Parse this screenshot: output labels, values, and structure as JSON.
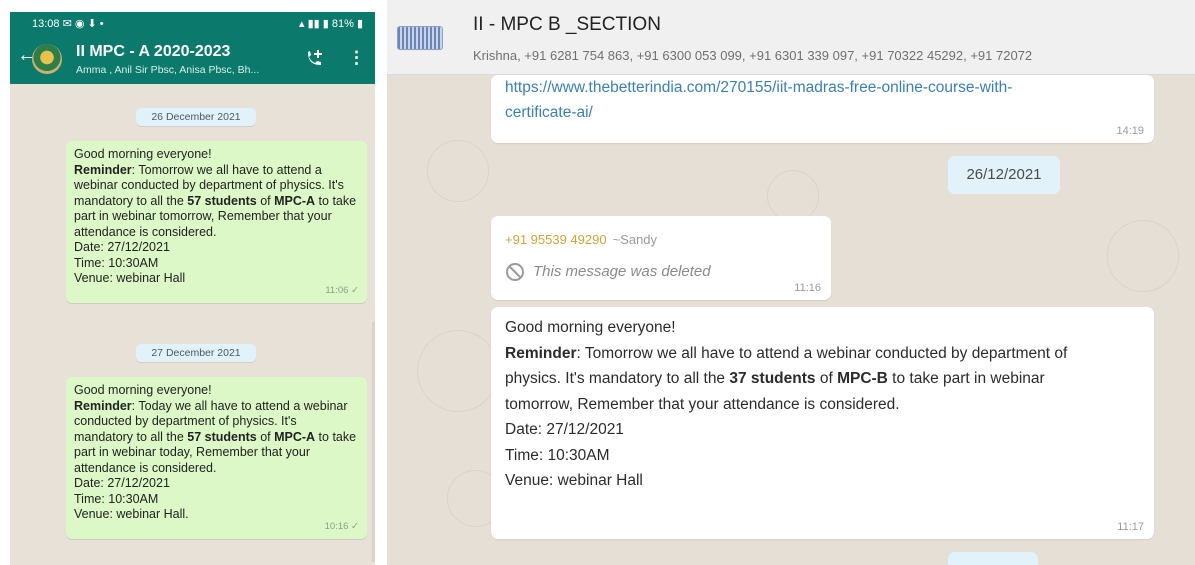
{
  "phone": {
    "status_time": "13:08",
    "status_icons": "✉ ◉ ⬇ •",
    "battery": "81%",
    "group_name": "II MPC - A 2020-2023",
    "group_members": "Amma , Anil Sir Pbsc, Anisa Pbsc, Bh...",
    "date1": "26 December 2021",
    "date2": "27 December 2021",
    "msg1": {
      "greeting": "Good morning everyone!",
      "reminder_label": "Reminder",
      "body_a": ": Tomorrow we all have to attend a webinar conducted by department of physics. It's mandatory to all the ",
      "count": "57 students",
      "of": " of ",
      "section": "MPC-A",
      "body_b": " to take part in webinar tomorrow, Remember that your attendance is considered.",
      "date_line": "Date: 27/12/2021",
      "time_line": "Time: 10:30AM",
      "venue_line": "Venue: webinar Hall",
      "time": "11:06 ✓"
    },
    "msg2": {
      "greeting": "Good morning everyone!",
      "reminder_label": "Reminder",
      "body_a": ": Today we all have to attend a webinar conducted by department of physics. It's mandatory to all the ",
      "count": "57 students",
      "of": " of ",
      "section": "MPC-A",
      "body_b": " to take part in webinar today, Remember that your attendance is considered.",
      "date_line": "Date: 27/12/2021",
      "time_line": "Time: 10:30AM",
      "venue_line": "Venue: webinar Hall.",
      "time": "10:16 ✓"
    }
  },
  "web": {
    "group_name": "II - MPC B _SECTION",
    "members": "Krishna, +91 6281 754 863, +91 6300 053 099, +91 6301 339 097, +91 70322 45292, +91 72072",
    "link_msg": {
      "line1": "https://www.thebetterindia.com/270155/iit-madras-free-online-course-with-",
      "line2": "certificate-ai/",
      "time": "14:19"
    },
    "date_chip": "26/12/2021",
    "deleted_msg": {
      "phone": "+91 95539 49290",
      "nick": "~Sandy",
      "text": "This message was deleted",
      "time": "11:16"
    },
    "main_msg": {
      "greeting": "Good morning everyone!",
      "reminder_label": "Reminder",
      "body_a": ": Tomorrow we all have to attend a webinar conducted by department of physics. It's mandatory to all the ",
      "count": "37 students",
      "of": " of ",
      "section": "MPC-B",
      "body_b": " to take part in webinar tomorrow, Remember that your attendance is considered.",
      "date_line": "Date: 27/12/2021",
      "time_line": "Time: 10:30AM",
      "venue_line": "Venue: webinar Hall",
      "time": "11:17"
    }
  }
}
